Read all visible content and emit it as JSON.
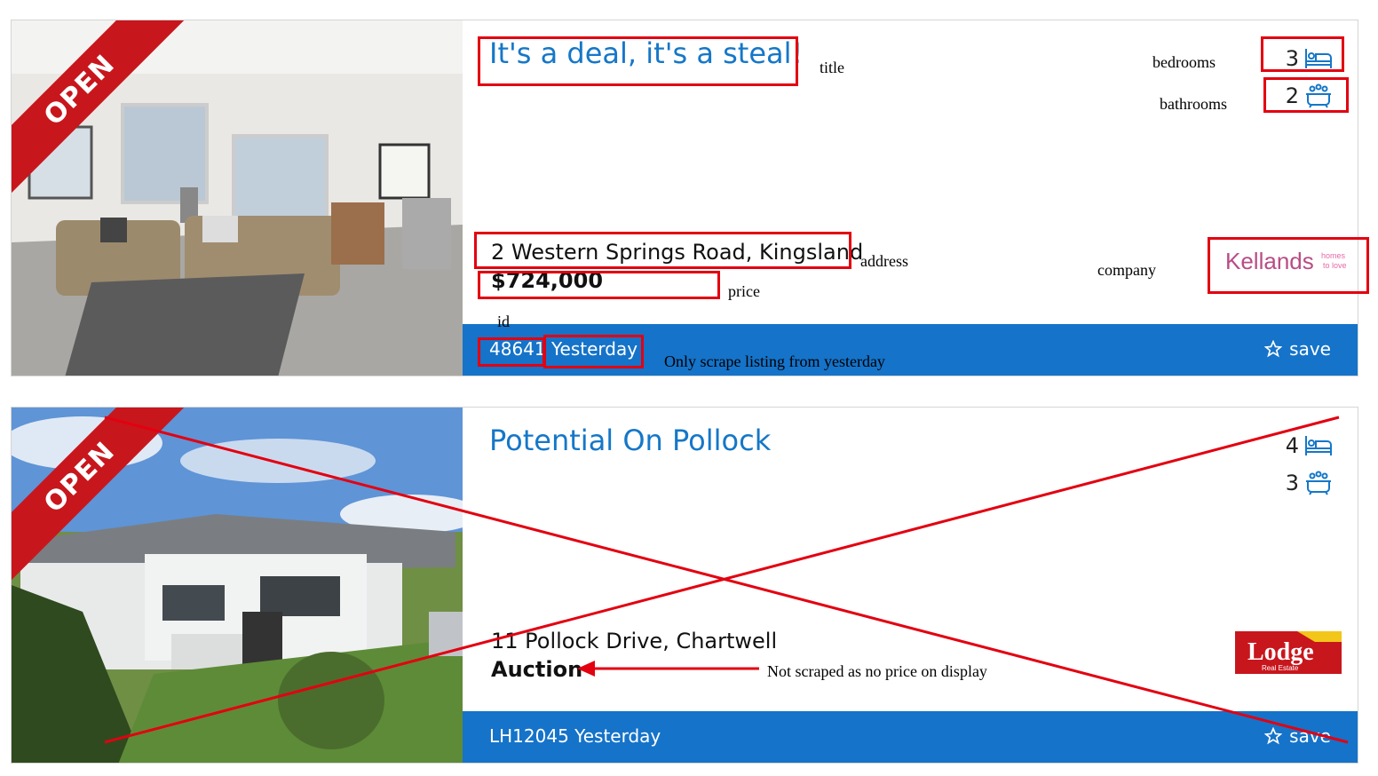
{
  "listings": [
    {
      "ribbon": "OPEN",
      "title": "It's a deal, it's a steal!",
      "bedrooms": "3",
      "bathrooms": "2",
      "address": "2 Western Springs Road, Kingsland",
      "price": "$724,000",
      "id": "48641",
      "date": "Yesterday",
      "save_label": "save",
      "company_logo": {
        "text": "Kellands",
        "tagline": "homes to love",
        "color": "#b84d86"
      },
      "photo": "living-room"
    },
    {
      "ribbon": "OPEN",
      "title": "Potential On Pollock",
      "bedrooms": "4",
      "bathrooms": "3",
      "address": "11 Pollock Drive, Chartwell",
      "price": "Auction",
      "id": "LH12045",
      "date": "Yesterday",
      "save_label": "save",
      "company_logo": {
        "text": "Lodge",
        "tagline": "Real Estate",
        "color": "#c8161d"
      },
      "photo": "house-exterior"
    }
  ],
  "annotations": {
    "title": "title",
    "bedrooms": "bedrooms",
    "bathrooms": "bathrooms",
    "address": "address",
    "price": "price",
    "company": "company",
    "id": "id",
    "yesterday_note": "Only scrape listing from yesterday",
    "no_price_note": "Not scraped as no price on display"
  },
  "colors": {
    "accent": "#1573c9",
    "ribbon": "#c8161d",
    "annotation": "#e30010"
  },
  "icons": [
    "bed-icon",
    "bath-icon",
    "star-icon"
  ]
}
